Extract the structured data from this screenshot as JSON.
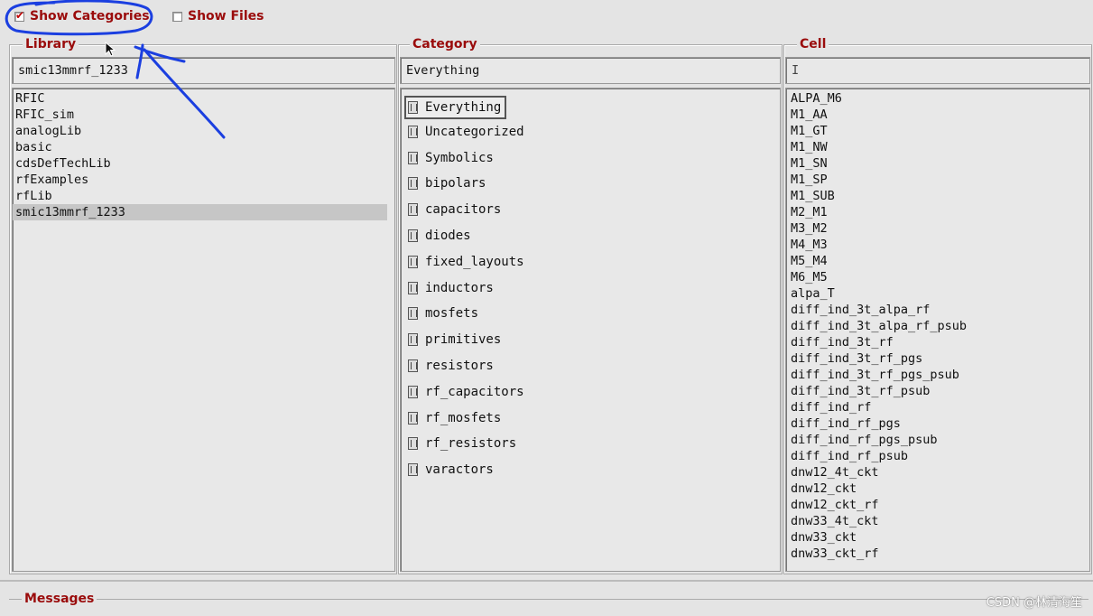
{
  "toolbar": {
    "show_categories": {
      "label": "Show Categories",
      "checked": true
    },
    "show_files": {
      "label": "Show Files",
      "checked": false
    }
  },
  "library": {
    "title": "Library",
    "value": "smic13mmrf_1233",
    "items": [
      "RFIC",
      "RFIC_sim",
      "analogLib",
      "basic",
      "cdsDefTechLib",
      "rfExamples",
      "rfLib",
      "smic13mmrf_1233"
    ],
    "selected": "smic13mmrf_1233"
  },
  "category": {
    "title": "Category",
    "value": "Everything",
    "items": [
      "Everything",
      "Uncategorized",
      "Symbolics",
      "bipolars",
      "capacitors",
      "diodes",
      "fixed_layouts",
      "inductors",
      "mosfets",
      "primitives",
      "resistors",
      "rf_capacitors",
      "rf_mosfets",
      "rf_resistors",
      "varactors"
    ],
    "selected": "Everything"
  },
  "cell": {
    "title": "Cell",
    "value": "",
    "items": [
      "ALPA_M6",
      "M1_AA",
      "M1_GT",
      "M1_NW",
      "M1_SN",
      "M1_SP",
      "M1_SUB",
      "M2_M1",
      "M3_M2",
      "M4_M3",
      "M5_M4",
      "M6_M5",
      "alpa_T",
      "diff_ind_3t_alpa_rf",
      "diff_ind_3t_alpa_rf_psub",
      "diff_ind_3t_rf",
      "diff_ind_3t_rf_pgs",
      "diff_ind_3t_rf_pgs_psub",
      "diff_ind_3t_rf_psub",
      "diff_ind_rf",
      "diff_ind_rf_pgs",
      "diff_ind_rf_pgs_psub",
      "diff_ind_rf_psub",
      "dnw12_4t_ckt",
      "dnw12_ckt",
      "dnw12_ckt_rf",
      "dnw33_4t_ckt",
      "dnw33_ckt",
      "dnw33_ckt_rf"
    ]
  },
  "messages": {
    "title": "Messages"
  },
  "watermark": "CSDN @林清海笙",
  "colors": {
    "label_red": "#9a0b0b",
    "annotation_blue": "#1b3fe0",
    "selection": "#c6c6c6"
  }
}
